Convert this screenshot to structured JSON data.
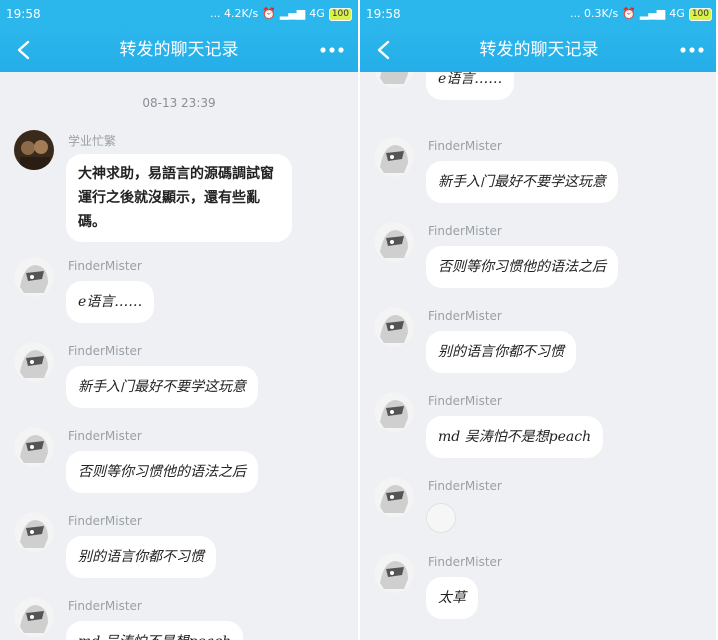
{
  "left": {
    "status": {
      "time": "19:58",
      "network": "... 4.2K/s",
      "signal": "4G",
      "battery": "100"
    },
    "title": "转发的聊天记录",
    "date": "08-13 23:39",
    "messages": [
      {
        "sender": "学业忙繁",
        "text": "大神求助，易語言的源碼調試窗運行之後就沒顯示，還有些亂碼。"
      },
      {
        "sender": "FinderMister",
        "text": "e语言……"
      },
      {
        "sender": "FinderMister",
        "text": "新手入门最好不要学这玩意"
      },
      {
        "sender": "FinderMister",
        "text": "否则等你习惯他的语法之后"
      },
      {
        "sender": "FinderMister",
        "text": "别的语言你都不习惯"
      },
      {
        "sender": "FinderMister",
        "text": "md 吴涛怕不是想peach"
      }
    ]
  },
  "right": {
    "status": {
      "time": "19:58",
      "network": "... 0.3K/s",
      "signal": "4G",
      "battery": "100"
    },
    "title": "转发的聊天记录",
    "messages": [
      {
        "sender": "",
        "text": "e语言……"
      },
      {
        "sender": "FinderMister",
        "text": "新手入门最好不要学这玩意"
      },
      {
        "sender": "FinderMister",
        "text": "否则等你习惯他的语法之后"
      },
      {
        "sender": "FinderMister",
        "text": "别的语言你都不习惯"
      },
      {
        "sender": "FinderMister",
        "text": "md 吴涛怕不是想peach"
      },
      {
        "sender": "FinderMister",
        "text": ""
      },
      {
        "sender": "FinderMister",
        "text": "太草"
      }
    ]
  },
  "colors": {
    "header": "#2bb6ec",
    "background": "#eef0f3",
    "bubble": "#ffffff"
  },
  "icons": [
    "back-arrow-icon",
    "more-dots-icon",
    "alarm-icon",
    "signal-icon",
    "battery-icon",
    "sticker-icon"
  ]
}
